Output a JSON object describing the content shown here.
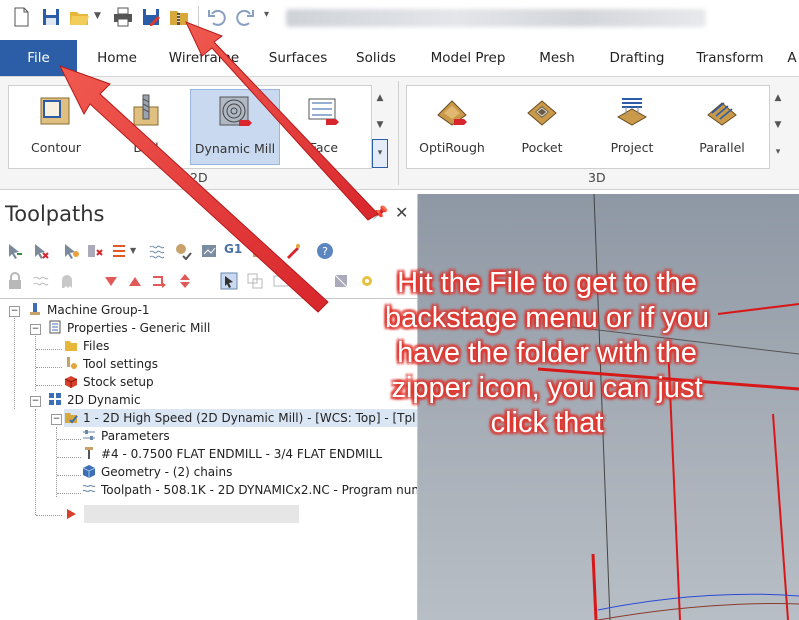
{
  "ribbon_tabs": [
    "File",
    "Home",
    "Wireframe",
    "Surfaces",
    "Solids",
    "Model Prep",
    "Mesh",
    "Drafting",
    "Transform",
    "A"
  ],
  "ribbon": {
    "group_2d": {
      "label": "2D",
      "buttons": [
        "Contour",
        "Drill",
        "Dynamic Mill",
        "Face"
      ]
    },
    "group_3d": {
      "label": "3D",
      "buttons": [
        "OptiRough",
        "Pocket",
        "Project",
        "Parallel"
      ]
    }
  },
  "toolpaths_panel": {
    "title": "Toolpaths",
    "pin_icon": "pin-icon",
    "close_icon": "close-icon"
  },
  "tree": {
    "machine_group": "Machine Group-1",
    "properties": "Properties - Generic Mill",
    "files": "Files",
    "tool_settings": "Tool settings",
    "stock_setup": "Stock setup",
    "group_2d_dynamic": "2D Dynamic",
    "operation": "1 - 2D High Speed (2D Dynamic Mill) - [WCS: Top] - [Tpl",
    "parameters": "Parameters",
    "tool": "#4 - 0.7500 FLAT ENDMILL - 3/4 FLAT ENDMILL",
    "geometry": "Geometry - (2) chains",
    "toolpath": "Toolpath - 508.1K - 2D DYNAMICx2.NC - Program nun"
  },
  "annotation": {
    "text": "Hit the File to get to the backstage menu or if you have the folder with the zipper icon, you can just click that",
    "color": "#e0362f"
  },
  "colors": {
    "file_tab": "#2c5ea8",
    "selected_button": "#c9d9f0",
    "arrow": "#e0362f"
  }
}
